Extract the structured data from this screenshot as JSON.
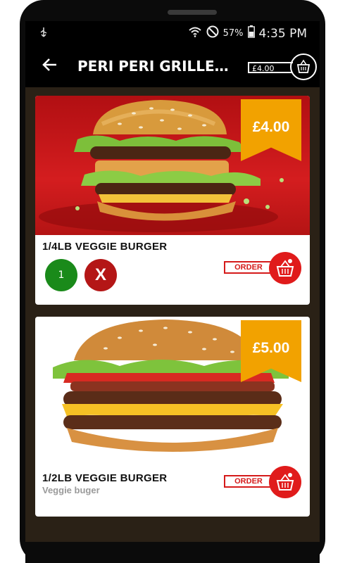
{
  "status_bar": {
    "battery_percent": "57%",
    "time": "4:35 PM",
    "icons": [
      "usb-icon",
      "wifi-icon",
      "do-not-disturb-icon",
      "battery-icon"
    ]
  },
  "app_bar": {
    "title": "PERI PERI GRILLED C...",
    "cart_total": "£4.00",
    "icons": [
      "back-arrow-icon",
      "cart-basket-icon"
    ]
  },
  "products": [
    {
      "name": "1/4LB VEGGIE BURGER",
      "price": "£4.00",
      "quantity": "1",
      "remove_label": "X",
      "order_label": "ORDER"
    },
    {
      "name": "1/2LB VEGGIE BURGER",
      "description": "Veggie buger",
      "price": "£5.00",
      "order_label": "ORDER"
    }
  ],
  "colors": {
    "price_tag": "#f2a200",
    "order_red": "#e01b1b",
    "quantity_green": "#1a8a1a",
    "remove_red": "#b41616"
  }
}
